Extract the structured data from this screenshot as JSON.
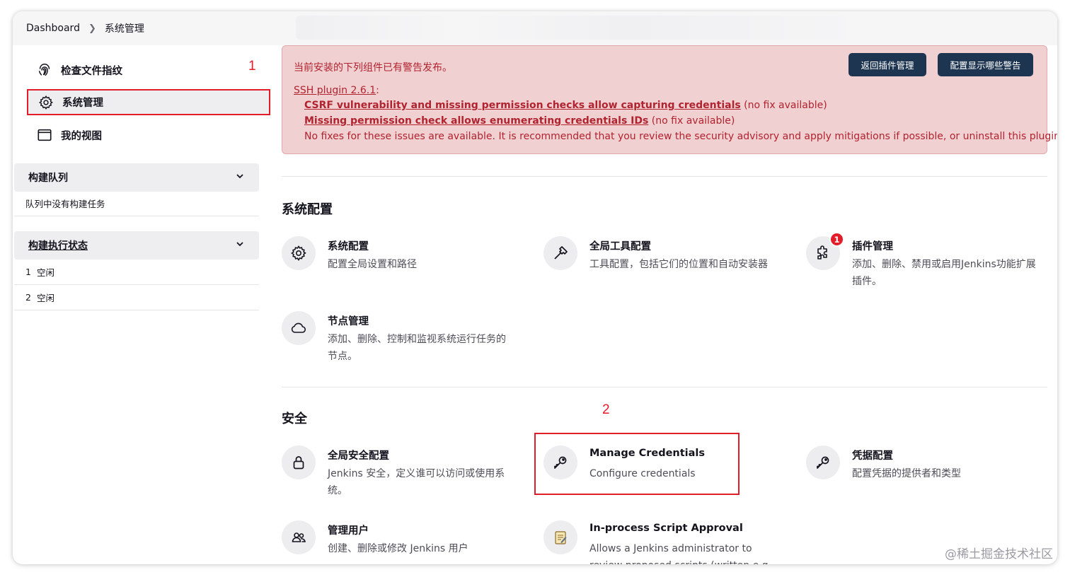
{
  "breadcrumb": {
    "home": "Dashboard",
    "current": "系统管理"
  },
  "sidebar": {
    "items": [
      {
        "label": "检查文件指纹",
        "icon": "fingerprint-icon"
      },
      {
        "label": "系统管理",
        "icon": "gear-icon"
      },
      {
        "label": "我的视图",
        "icon": "window-icon"
      }
    ],
    "marker": "1",
    "build_queue": {
      "title": "构建队列",
      "empty": "队列中没有构建任务"
    },
    "executors": {
      "title": "构建执行状态",
      "rows": [
        {
          "num": "1",
          "status": "空闲"
        },
        {
          "num": "2",
          "status": "空闲"
        }
      ]
    }
  },
  "alert": {
    "message": "当前安装的下列组件已有警告发布。",
    "buttons": [
      "返回插件管理",
      "配置显示哪些警告"
    ],
    "plugin": "SSH plugin 2.6.1",
    "plugin_suffix": ":",
    "issues": [
      {
        "text": "CSRF vulnerability and missing permission checks allow capturing credentials",
        "note": "(no fix available)"
      },
      {
        "text": "Missing permission check allows enumerating credentials IDs",
        "note": "(no fix available)"
      }
    ],
    "footer": "No fixes for these issues are available. It is recommended that you review the security advisory and apply mitigations if possible, or uninstall this plugin."
  },
  "system_config": {
    "title": "系统配置",
    "tiles": [
      {
        "title": "系统配置",
        "desc": "配置全局设置和路径",
        "icon": "gear-icon"
      },
      {
        "title": "全局工具配置",
        "desc": "工具配置，包括它们的位置和自动安装器",
        "icon": "hammer-icon"
      },
      {
        "title": "插件管理",
        "desc": "添加、删除、禁用或启用Jenkins功能扩展插件。",
        "icon": "puzzle-icon",
        "badge": "1"
      },
      {
        "title": "节点管理",
        "desc": "添加、删除、控制和监视系统运行任务的节点。",
        "icon": "cloud-icon"
      }
    ]
  },
  "security": {
    "title": "安全",
    "marker": "2",
    "tiles": [
      {
        "title": "全局安全配置",
        "desc": "Jenkins 安全，定义谁可以访问或使用系统。",
        "icon": "lock-icon"
      },
      {
        "title": "Manage Credentials",
        "desc": "Configure credentials",
        "icon": "key-icon"
      },
      {
        "title": "凭据配置",
        "desc": "配置凭据的提供者和类型",
        "icon": "key-icon"
      },
      {
        "title": "管理用户",
        "desc": "创建、删除或修改 Jenkins 用户",
        "icon": "users-icon"
      },
      {
        "title": "In-process Script Approval",
        "desc": "Allows a Jenkins administrator to review proposed scripts (written e.g.",
        "icon": "notepad-icon"
      }
    ]
  },
  "watermark": "@稀土掘金技术社区",
  "colors": {
    "accent_red": "#e21d2a",
    "alert_bg": "#f1d0d2",
    "alert_text": "#b0232f",
    "button_dark": "#1d3550"
  }
}
